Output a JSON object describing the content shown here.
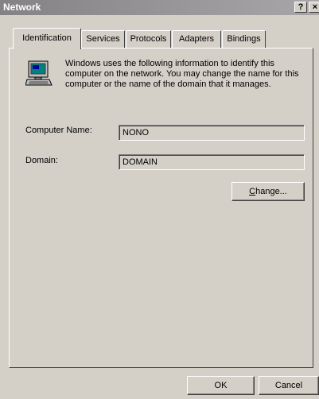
{
  "window": {
    "title": "Network",
    "help_glyph": "?",
    "close_glyph": "×"
  },
  "tabs": [
    {
      "label": "Identification",
      "active": true
    },
    {
      "label": "Services"
    },
    {
      "label": "Protocols"
    },
    {
      "label": "Adapters"
    },
    {
      "label": "Bindings"
    }
  ],
  "identification": {
    "icon": "computer-icon",
    "description": "Windows uses the following information to identify this computer on the network.  You may change the name for this computer or the name of the domain that it manages.",
    "computer_name_label": "Computer Name:",
    "computer_name_value": "NONO",
    "domain_label": "Domain:",
    "domain_value": "DOMAIN",
    "change_button": {
      "mnemonic": "C",
      "rest": "hange..."
    }
  },
  "footer": {
    "ok_label": "OK",
    "cancel_label": "Cancel"
  }
}
